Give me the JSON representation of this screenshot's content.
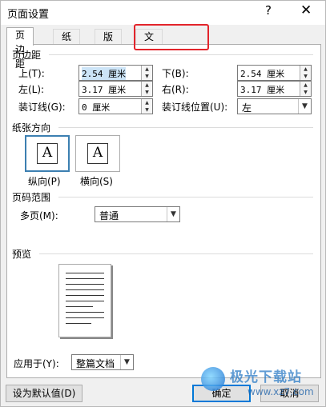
{
  "window": {
    "title": "页面设置",
    "help": "?",
    "close": "✕"
  },
  "tabs": [
    "页边距",
    "纸张",
    "版式",
    "文档网格"
  ],
  "margins": {
    "heading": "页边距",
    "top_label": "上(T):",
    "top_value": "2.54 厘米",
    "bottom_label": "下(B):",
    "bottom_value": "2.54 厘米",
    "left_label": "左(L):",
    "left_value": "3.17 厘米",
    "right_label": "右(R):",
    "right_value": "3.17 厘米",
    "gutter_label": "装订线(G):",
    "gutter_value": "0 厘米",
    "gutter_pos_label": "装订线位置(U):",
    "gutter_pos_value": "左"
  },
  "orientation": {
    "heading": "纸张方向",
    "portrait_label": "纵向(P)",
    "landscape_label": "横向(S)",
    "glyph": "A"
  },
  "pages": {
    "heading": "页码范围",
    "multiple_label": "多页(M):",
    "multiple_value": "普通"
  },
  "preview": {
    "heading": "预览"
  },
  "apply": {
    "label": "应用于(Y):",
    "value": "整篇文档"
  },
  "buttons": {
    "default": "设为默认值(D)",
    "ok": "确定",
    "cancel": "取消"
  },
  "watermark": {
    "text": "极光下载站",
    "url": "www.xz7.com"
  }
}
